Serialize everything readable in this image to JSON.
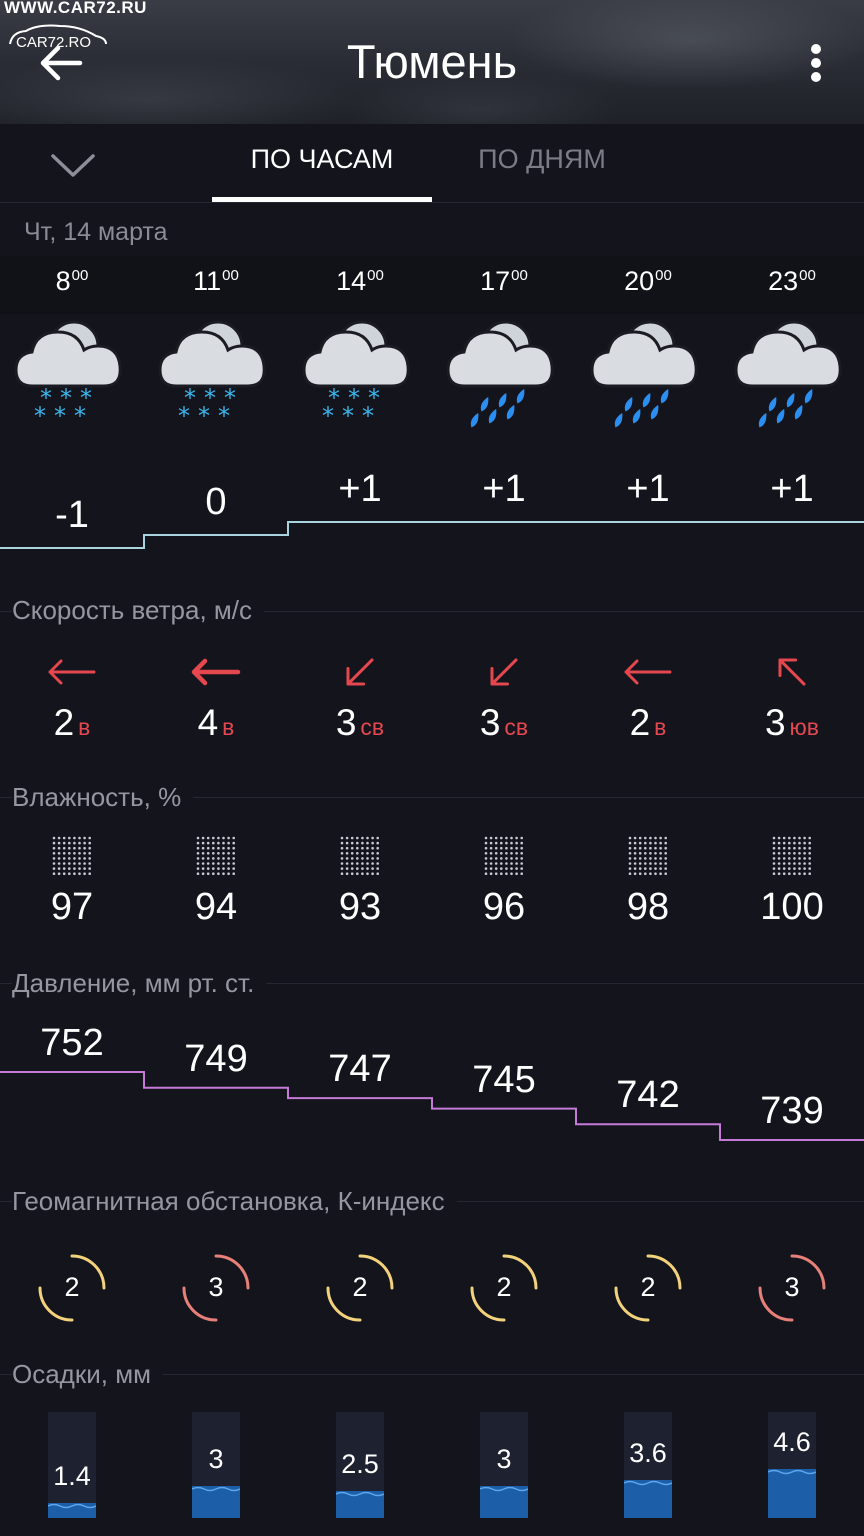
{
  "header": {
    "watermark_url": "WWW.CAR72.RU",
    "watermark_logo": "CAR72.RO",
    "title": "Тюмень",
    "back_icon": "arrow-left-icon",
    "menu_icon": "more-vertical-icon"
  },
  "tabs": [
    {
      "label": "ПО ЧАСАМ",
      "active": true
    },
    {
      "label": "ПО ДНЯМ",
      "active": false
    }
  ],
  "date": "Чт, 14 марта",
  "hours": [
    {
      "hour": "8",
      "min": "00",
      "icon": "cloud-snow-icon",
      "precip": "snow",
      "temp": "-1",
      "temp_num": -1,
      "wind_speed": "2",
      "wind_dir": "в",
      "wind_strong": false,
      "humidity": "97",
      "pressure": "752",
      "k_index": "2",
      "precip_mm": "1.4",
      "precip_num": 1.4
    },
    {
      "hour": "11",
      "min": "00",
      "icon": "cloud-snow-icon",
      "precip": "snow",
      "temp": "0",
      "temp_num": 0,
      "wind_speed": "4",
      "wind_dir": "в",
      "wind_strong": true,
      "humidity": "94",
      "pressure": "749",
      "k_index": "3",
      "precip_mm": "3",
      "precip_num": 3
    },
    {
      "hour": "14",
      "min": "00",
      "icon": "cloud-snow-icon",
      "precip": "snow",
      "temp": "+1",
      "temp_num": 1,
      "wind_speed": "3",
      "wind_dir": "св",
      "wind_strong": false,
      "humidity": "93",
      "pressure": "747",
      "k_index": "2",
      "precip_mm": "2.5",
      "precip_num": 2.5
    },
    {
      "hour": "17",
      "min": "00",
      "icon": "cloud-rain-icon",
      "precip": "rain",
      "temp": "+1",
      "temp_num": 1,
      "wind_speed": "3",
      "wind_dir": "св",
      "wind_strong": false,
      "humidity": "96",
      "pressure": "745",
      "k_index": "2",
      "precip_mm": "3",
      "precip_num": 3
    },
    {
      "hour": "20",
      "min": "00",
      "icon": "cloud-rain-icon",
      "precip": "rain",
      "temp": "+1",
      "temp_num": 1,
      "wind_speed": "2",
      "wind_dir": "в",
      "wind_strong": false,
      "humidity": "98",
      "pressure": "742",
      "k_index": "2",
      "precip_mm": "3.6",
      "precip_num": 3.6
    },
    {
      "hour": "23",
      "min": "00",
      "icon": "cloud-rain-icon",
      "precip": "rain",
      "temp": "+1",
      "temp_num": 1,
      "wind_speed": "3",
      "wind_dir": "юв",
      "wind_strong": false,
      "humidity": "100",
      "pressure": "739",
      "k_index": "3",
      "precip_mm": "4.6",
      "precip_num": 4.6
    }
  ],
  "sections": {
    "wind": "Скорость ветра, м/с",
    "humidity": "Влажность, %",
    "pressure": "Давление, мм рт. ст.",
    "geomagnetic": "Геомагнитная обстановка, К-индекс",
    "precipitation": "Осадки, мм"
  },
  "colors": {
    "background": "#14141d",
    "temp_line": "#a9d4dd",
    "pressure_line": "#c57ad8",
    "wind_arrow": "#e5474f",
    "k_index_2": "#f2d27a",
    "k_index_3": "#e8807a",
    "snow": "#3ab6ec",
    "rain": "#2a8ff0",
    "precip_water": "#1d5ea8"
  }
}
